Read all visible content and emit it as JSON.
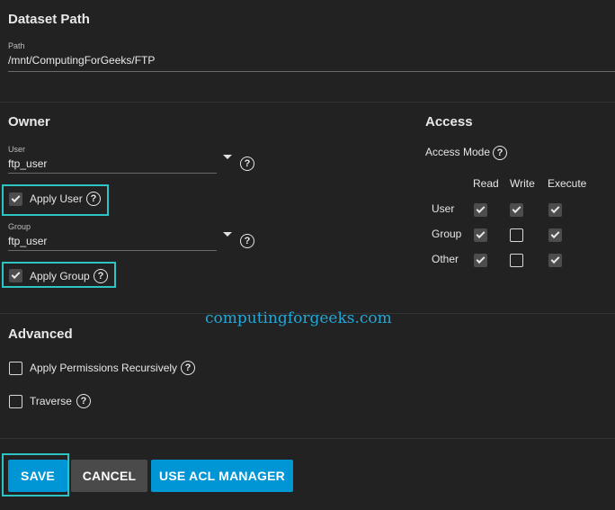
{
  "dataset": {
    "title": "Dataset Path",
    "path_label": "Path",
    "path_value": "/mnt/ComputingForGeeks/FTP"
  },
  "owner": {
    "title": "Owner",
    "user_label": "User",
    "user_value": "ftp_user",
    "apply_user_label": "Apply User",
    "apply_user_checked": true,
    "group_label": "Group",
    "group_value": "ftp_user",
    "apply_group_label": "Apply Group",
    "apply_group_checked": true
  },
  "access": {
    "title": "Access",
    "mode_label": "Access Mode",
    "columns": [
      "Read",
      "Write",
      "Execute"
    ],
    "rows": [
      {
        "label": "User",
        "read": true,
        "write": true,
        "execute": true
      },
      {
        "label": "Group",
        "read": true,
        "write": false,
        "execute": true
      },
      {
        "label": "Other",
        "read": true,
        "write": false,
        "execute": true
      }
    ]
  },
  "watermark": "computingforgeeks.com",
  "advanced": {
    "title": "Advanced",
    "recursive_label": "Apply Permissions Recursively",
    "recursive_checked": false,
    "traverse_label": "Traverse",
    "traverse_checked": false
  },
  "buttons": {
    "save": "SAVE",
    "cancel": "CANCEL",
    "acl": "USE ACL MANAGER"
  },
  "colors": {
    "primary": "#0095d5",
    "highlight": "#2ec4c4",
    "background": "#222222"
  }
}
